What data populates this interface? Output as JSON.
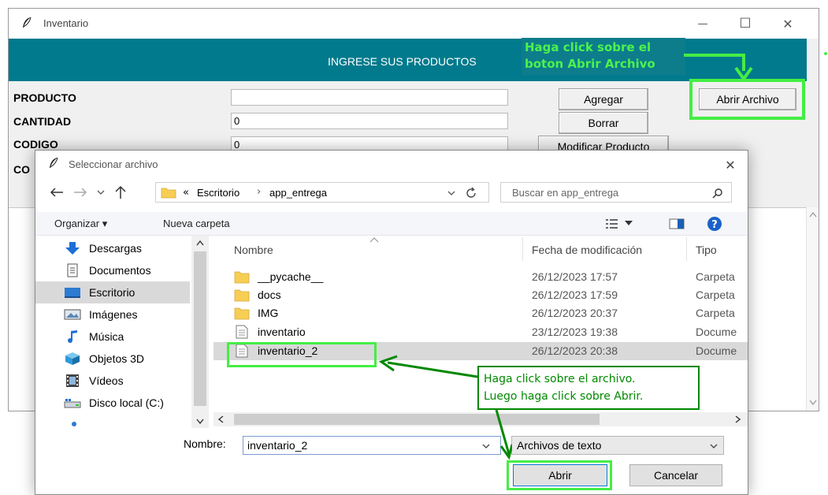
{
  "app": {
    "title": "Inventario",
    "header": "INGRESE SUS PRODUCTOS",
    "labels": {
      "producto": "PRODUCTO",
      "cantidad": "CANTIDAD",
      "codigo": "CODIGO",
      "fourth_partial": "CO"
    },
    "values": {
      "producto": "",
      "cantidad": "0",
      "codigo": "0"
    },
    "buttons": {
      "agregar": "Agregar",
      "borrar": "Borrar",
      "modificar": "Modificar Producto",
      "abrir_archivo": "Abrir Archivo"
    },
    "window_controls": {
      "minimize": "—",
      "maximize": "☐",
      "close": "✕"
    }
  },
  "dialog": {
    "title": "Seleccionar archivo",
    "breadcrumb": {
      "prefix": "«",
      "parts": [
        "Escritorio",
        "app_entrega"
      ],
      "sep": "›"
    },
    "search_placeholder": "Buscar en app_entrega",
    "toolbar": {
      "organize": "Organizar ▾",
      "new_folder": "Nueva carpeta"
    },
    "nav_items": [
      {
        "label": "Descargas",
        "icon": "download-arrow-icon"
      },
      {
        "label": "Documentos",
        "icon": "documents-icon"
      },
      {
        "label": "Escritorio",
        "icon": "desktop-icon",
        "selected": true
      },
      {
        "label": "Imágenes",
        "icon": "images-icon"
      },
      {
        "label": "Música",
        "icon": "music-note-icon"
      },
      {
        "label": "Objetos 3D",
        "icon": "cube-3d-icon"
      },
      {
        "label": "Vídeos",
        "icon": "film-icon"
      },
      {
        "label": "Disco local (C:)",
        "icon": "local-disk-icon"
      }
    ],
    "columns": {
      "name": "Nombre",
      "date": "Fecha de modificación",
      "type": "Tipo"
    },
    "files": [
      {
        "name": "__pycache__",
        "date": "26/12/2023 17:57",
        "type": "Carpeta",
        "kind": "folder"
      },
      {
        "name": "docs",
        "date": "26/12/2023 17:59",
        "type": "Carpeta",
        "kind": "folder"
      },
      {
        "name": "IMG",
        "date": "26/12/2023 20:37",
        "type": "Carpeta",
        "kind": "folder"
      },
      {
        "name": "inventario",
        "date": "23/12/2023 19:38",
        "type": "Docume",
        "kind": "file"
      },
      {
        "name": "inventario_2",
        "date": "26/12/2023 20:38",
        "type": "Docume",
        "kind": "file",
        "selected": true
      }
    ],
    "filename_label": "Nombre:",
    "filename_value": "inventario_2",
    "filter_value": "Archivos de texto",
    "buttons": {
      "open": "Abrir",
      "cancel": "Cancelar"
    }
  },
  "annotations": {
    "top_line1": "Haga click sobre el",
    "top_line2": "boton Abrir Archivo",
    "mid_line1": "Haga click sobre el archivo.",
    "mid_line2": "Luego haga click sobre Abrir."
  },
  "colors": {
    "header": "#007a8c",
    "annotation_green": "#44ee44",
    "callout_green": "#008800",
    "selection": "#cce8ff"
  }
}
